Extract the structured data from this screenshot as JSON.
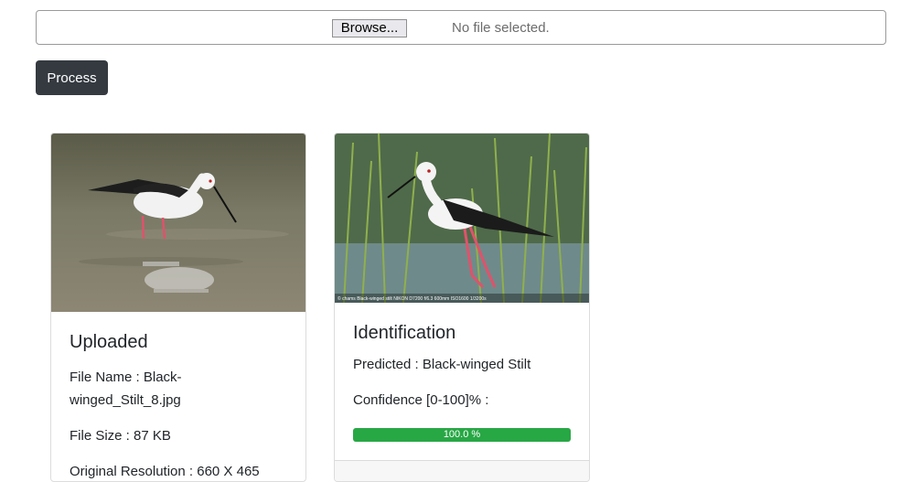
{
  "upload": {
    "browse_label": "Browse...",
    "file_status": "No file selected."
  },
  "process_label": "Process",
  "uploaded_card": {
    "title": "Uploaded",
    "file_name": "File Name : Black-winged_Stilt_8.jpg",
    "file_size": "File Size : 87 KB",
    "resolution": "Original Resolution : 660 X 465"
  },
  "identification_card": {
    "title": "Identification",
    "predicted": "Predicted : Black-winged Stilt",
    "confidence_label": "Confidence [0-100]% :",
    "confidence_value": 100.0,
    "confidence_text": "100.0 %",
    "image_caption": "© chams  Black-winged stilt  NIKON D7200  f/6.3  600mm  ISO1600  1/3200s"
  },
  "colors": {
    "process_bg": "#343a40",
    "progress_fill": "#28a745",
    "bird_leg": "#e0526b"
  }
}
